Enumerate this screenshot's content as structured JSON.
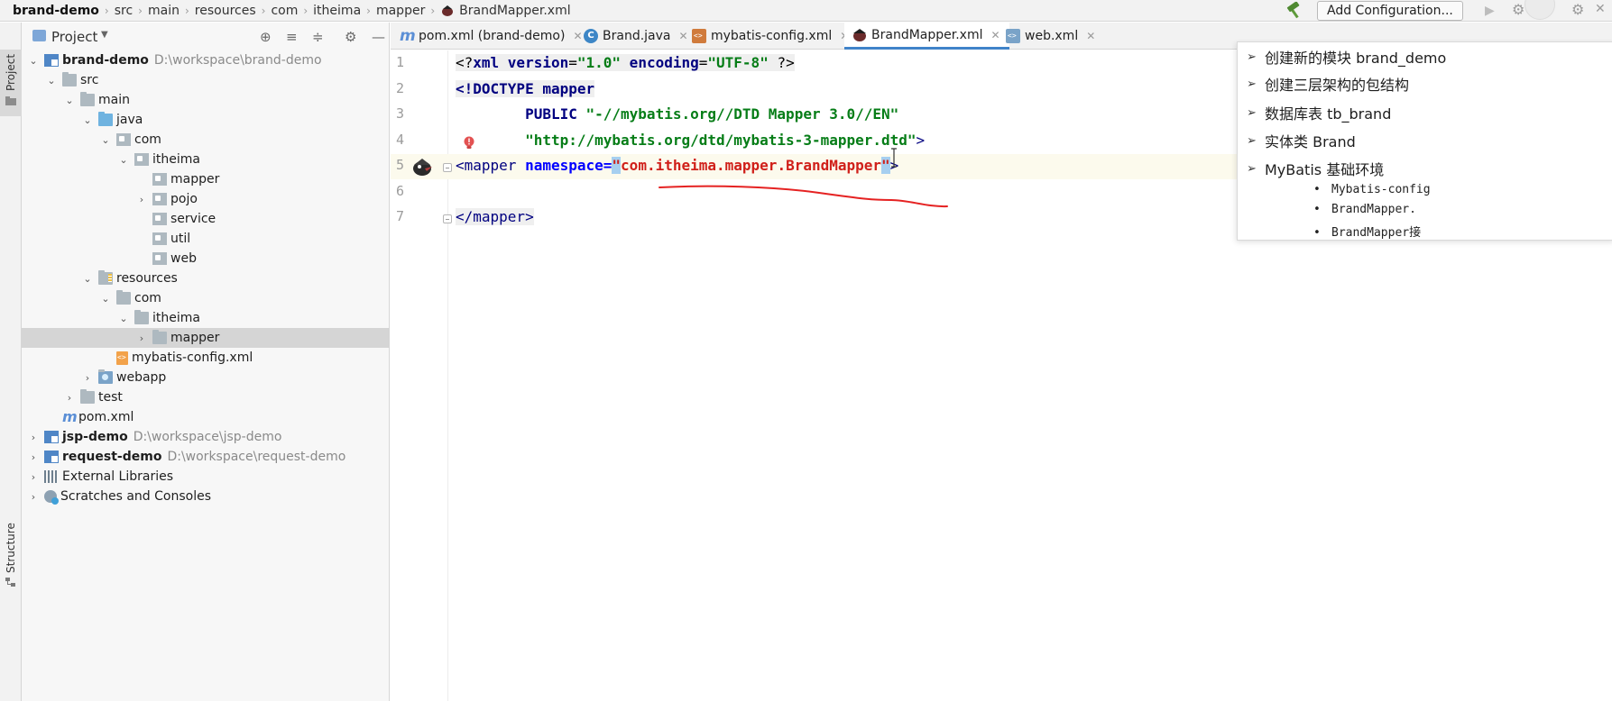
{
  "breadcrumb": {
    "items": [
      "brand-demo",
      "src",
      "main",
      "resources",
      "com",
      "itheima",
      "mapper"
    ],
    "file": "BrandMapper.xml"
  },
  "toolbar": {
    "add_configuration_label": "Add Configuration..."
  },
  "left_strip": {
    "project_label": "Project",
    "structure_label": "Structure"
  },
  "project_panel": {
    "title": "Project"
  },
  "tree": [
    {
      "name": "brand-demo",
      "path": "D:\\workspace\\brand-demo",
      "bold": true,
      "icon": "module-icon",
      "arrow": "down"
    },
    {
      "name": "src",
      "icon": "folder-icon",
      "arrow": "down"
    },
    {
      "name": "main",
      "icon": "folder-icon",
      "arrow": "down"
    },
    {
      "name": "java",
      "icon": "source-folder-icon",
      "arrow": "down"
    },
    {
      "name": "com",
      "icon": "package-icon",
      "arrow": "down"
    },
    {
      "name": "itheima",
      "icon": "package-icon",
      "arrow": "down"
    },
    {
      "name": "mapper",
      "icon": "package-icon",
      "arrow": ""
    },
    {
      "name": "pojo",
      "icon": "package-icon",
      "arrow": "right"
    },
    {
      "name": "service",
      "icon": "package-icon",
      "arrow": ""
    },
    {
      "name": "util",
      "icon": "package-icon",
      "arrow": ""
    },
    {
      "name": "web",
      "icon": "package-icon",
      "arrow": ""
    },
    {
      "name": "resources",
      "icon": "resources-folder-icon",
      "arrow": "down"
    },
    {
      "name": "com",
      "icon": "folder-icon",
      "arrow": "down"
    },
    {
      "name": "itheima",
      "icon": "folder-icon",
      "arrow": "down"
    },
    {
      "name": "mapper",
      "icon": "folder-icon",
      "arrow": "right"
    },
    {
      "name": "mybatis-config.xml",
      "icon": "xml-file-icon",
      "arrow": ""
    },
    {
      "name": "webapp",
      "icon": "web-folder-icon",
      "arrow": "right"
    },
    {
      "name": "test",
      "icon": "folder-icon",
      "arrow": "right"
    },
    {
      "name": "pom.xml",
      "icon": "maven-icon",
      "arrow": ""
    },
    {
      "name": "jsp-demo",
      "path": "D:\\workspace\\jsp-demo",
      "bold": true,
      "icon": "module-icon",
      "arrow": "right"
    },
    {
      "name": "request-demo",
      "path": "D:\\workspace\\request-demo",
      "bold": true,
      "icon": "module-icon",
      "arrow": "right"
    },
    {
      "name": "External Libraries",
      "icon": "libraries-icon",
      "arrow": "right"
    },
    {
      "name": "Scratches and Consoles",
      "icon": "scratches-icon",
      "arrow": "right"
    }
  ],
  "tabs": [
    {
      "label": "pom.xml (brand-demo)",
      "icon": "maven-icon"
    },
    {
      "label": "Brand.java",
      "icon": "class-icon"
    },
    {
      "label": "mybatis-config.xml",
      "icon": "xml-file-icon"
    },
    {
      "label": "BrandMapper.xml",
      "icon": "mybatis-icon",
      "active": true
    },
    {
      "label": "web.xml",
      "icon": "web-xml-icon"
    }
  ],
  "editor": {
    "line_numbers": [
      "1",
      "2",
      "3",
      "4",
      "5",
      "6",
      "7"
    ],
    "code": {
      "l1_a": "<?",
      "l1_b": "xml version",
      "l1_c": "=",
      "l1_d": "\"1.0\"",
      "l1_e": " encoding",
      "l1_f": "=",
      "l1_g": "\"UTF-8\"",
      "l1_h": " ?>",
      "l2_a": "<!DOCTYPE ",
      "l2_b": "mapper",
      "l3_a": "        PUBLIC ",
      "l3_b": "\"-//mybatis.org//DTD Mapper 3.0//EN\"",
      "l4_a": "        \"http://mybatis.org/dtd/mybatis-3-mapper.dtd\"",
      "l4_b": ">",
      "l5_a": "<mapper ",
      "l5_b": "namespace",
      "l5_c": "=",
      "l5_d": "\"",
      "l5_e": "com.itheima.mapper.BrandMapper",
      "l5_f": "\"",
      "l5_g": ">",
      "l7_a": "</mapper>"
    }
  },
  "outline": {
    "items": [
      "创建新的模块 brand_demo",
      "创建三层架构的包结构",
      "数据库表 tb_brand",
      "实体类 Brand",
      "MyBatis 基础环境"
    ],
    "subitems": [
      "Mybatis-config",
      "BrandMapper.",
      "BrandMapper接"
    ]
  },
  "colors": {
    "accent": "#4083c9",
    "annotation_red": "#e52222",
    "string_green": "#067d17",
    "keyword_navy": "#000080"
  }
}
